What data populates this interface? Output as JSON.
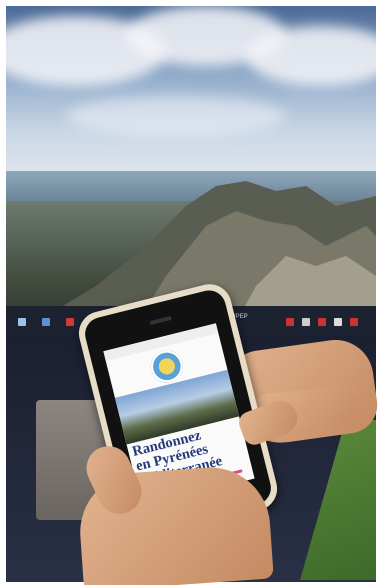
{
  "monitor": {
    "taskbar_label": "SAENAUPEP"
  },
  "phone": {
    "website_title_lines": [
      "Randonnez",
      "en Pyrénées",
      "Méditerranée"
    ]
  },
  "colors": {
    "title_blue": "#253a7a",
    "accent_pink": "#d94f7a",
    "phone_case": "#e7ddc6"
  }
}
